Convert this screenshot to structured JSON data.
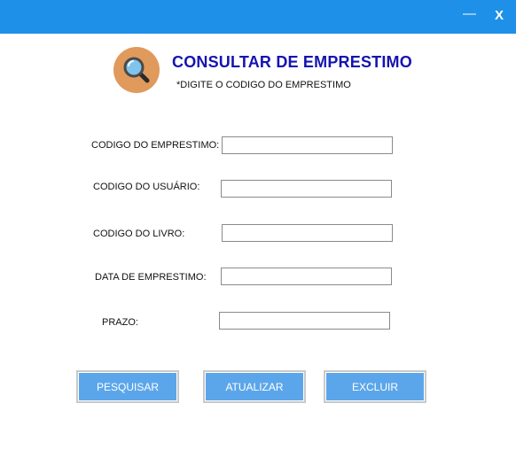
{
  "window": {
    "minimize_glyph": "—",
    "close_glyph": "X",
    "titlebar_color": "#1e90e8"
  },
  "header": {
    "logo_icon": "search-icon",
    "title": "CONSULTAR DE EMPRESTIMO",
    "subtitle": "*DIGITE O CODIGO DO EMPRESTIMO"
  },
  "form": {
    "fields": [
      {
        "label": "CODIGO DO EMPRESTIMO:",
        "value": ""
      },
      {
        "label": "CODIGO DO USUÁRIO:",
        "value": ""
      },
      {
        "label": "CODIGO DO LIVRO:",
        "value": ""
      },
      {
        "label": "DATA DE EMPRESTIMO:",
        "value": ""
      },
      {
        "label": "PRAZO:",
        "value": ""
      }
    ]
  },
  "actions": {
    "search_label": "PESQUISAR",
    "update_label": "ATUALIZAR",
    "delete_label": "EXCLUIR",
    "button_color": "#5ba6ea"
  }
}
